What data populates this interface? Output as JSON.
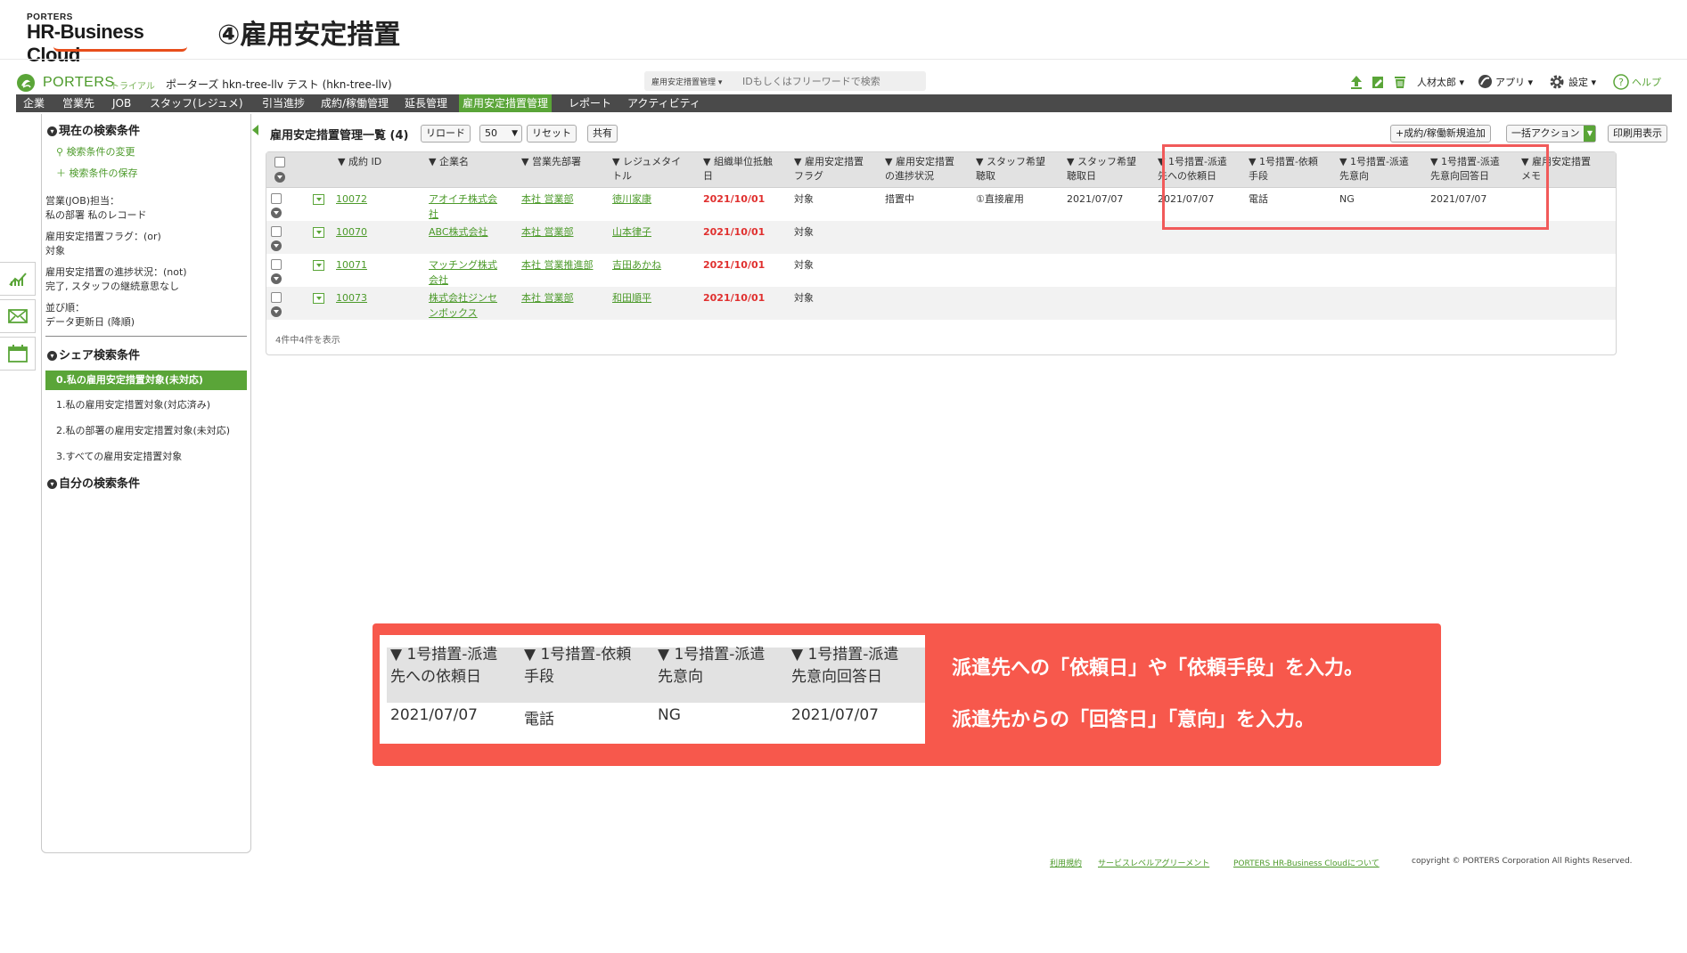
{
  "brand": {
    "small": "PORTERS",
    "big": "HR-Business Cloud"
  },
  "page_heading": "④雇用安定措置",
  "app": {
    "logo_text": "PORTERS",
    "trial": "トライアル",
    "tenant": "ポーターズ hkn-tree-llv テスト (hkn-tree-llv)",
    "search_scope": "雇用安定措置管理 ▾",
    "search_placeholder": "IDもしくはフリーワードで検索",
    "user": "人材太郎 ▾",
    "apps": "アプリ ▾",
    "settings": "設定 ▾",
    "help": "ヘルプ"
  },
  "nav": [
    "企業",
    "営業先",
    "JOB",
    "スタッフ(レジュメ)",
    "引当進捗",
    "成約/稼働管理",
    "延長管理",
    "雇用安定措置管理",
    "レポート",
    "アクティビティ"
  ],
  "nav_active": "雇用安定措置管理",
  "sidebar": {
    "current_head": "現在の検索条件",
    "change_link": "検索条件の変更",
    "save_link": "検索条件の保存",
    "cond1_label": "営業(JOB)担当：",
    "cond1_value": "私の部署 私のレコード",
    "cond2_label": "雇用安定措置フラグ：(or)",
    "cond2_value": "対象",
    "cond3_label": "雇用安定措置の進捗状況：(not)",
    "cond3_value": "完了, スタッフの継続意思なし",
    "sort_label": "並び順：",
    "sort_value": "データ更新日 (降順)",
    "share_head": "シェア検索条件",
    "share_items": [
      "0.私の雇用安定措置対象(未対応)",
      "1.私の雇用安定措置対象(対応済み)",
      "2.私の部署の雇用安定措置対象(未対応)",
      "3.すべての雇用安定措置対象"
    ],
    "own_head": "自分の検索条件"
  },
  "list": {
    "title": "雇用安定措置管理一覧 (4)",
    "reload": "リロード",
    "page_size": "50",
    "reset": "リセット",
    "share": "共有",
    "add": "+成約/稼働新規追加",
    "bulk": "一括アクション",
    "print": "印刷用表示",
    "count": "4件中4件を表示"
  },
  "table": {
    "headers": [
      "▼ 成約 ID",
      "▼ 企業名",
      "▼ 営業先部署",
      "▼ レジュメタイ\nトル",
      "▼ 組織単位抵触\n日",
      "▼ 雇用安定措置\nフラグ",
      "▼ 雇用安定措置\nの進捗状況",
      "▼ スタッフ希望\n聴取",
      "▼ スタッフ希望\n聴取日",
      "▼ 1号措置-派遣\n先への依頼日",
      "▼ 1号措置-依頼\n手段",
      "▼ 1号措置-派遣\n先意向",
      "▼ 1号措置-派遣\n先意向回答日",
      "▼ 雇用安定措置\nメモ"
    ],
    "rows": [
      [
        "10072",
        "アオイチ株式会\n社",
        "本社 営業部",
        "徳川家康",
        "2021/10/01",
        "対象",
        "措置中",
        "①直接雇用",
        "2021/07/07",
        "2021/07/07",
        "電話",
        "NG",
        "2021/07/07",
        ""
      ],
      [
        "10070",
        "ABC株式会社",
        "本社 営業部",
        "山本律子",
        "2021/10/01",
        "対象",
        "",
        "",
        "",
        "",
        "",
        "",
        "",
        ""
      ],
      [
        "10071",
        "マッチング株式\n会社",
        "本社 営業推進部",
        "吉田あかね",
        "2021/10/01",
        "対象",
        "",
        "",
        "",
        "",
        "",
        "",
        "",
        ""
      ],
      [
        "10073",
        "株式会社ジンセ\nンボックス",
        "本社 営業部",
        "和田順平",
        "2021/10/01",
        "対象",
        "",
        "",
        "",
        "",
        "",
        "",
        "",
        ""
      ]
    ]
  },
  "callout": {
    "zoom_headers": [
      "▼ 1号措置-派遣\n先への依頼日",
      "▼ 1号措置-依頼\n手段",
      "▼ 1号措置-派遣\n先意向",
      "▼ 1号措置-派遣\n先意向回答日"
    ],
    "zoom_values": [
      "2021/07/07",
      "電話",
      "NG",
      "2021/07/07"
    ],
    "line1": "派遣先への「依頼日」や「依頼手段」を入力。",
    "line2": "派遣先からの「回答日」「意向」を入力。"
  },
  "footer": {
    "terms": "利用規約",
    "sla": "サービスレベルアグリーメント",
    "about": "PORTERS HR-Business Cloudについて",
    "copyright": "copyright © PORTERS Corporation All Rights Reserved."
  }
}
